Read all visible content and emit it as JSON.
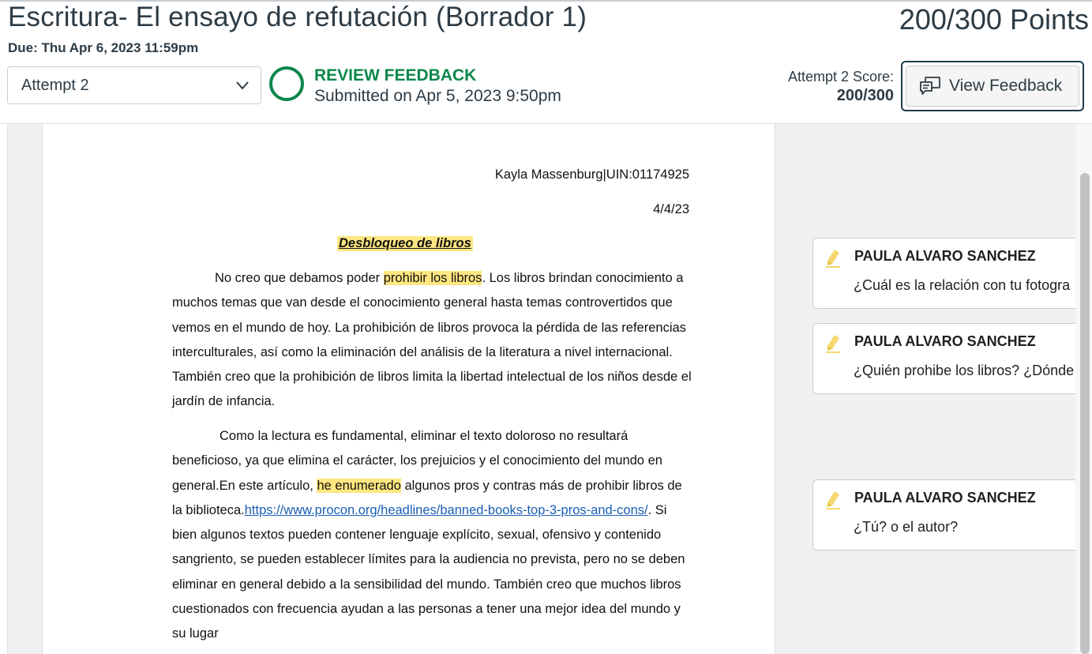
{
  "header": {
    "title": "Escritura- El ensayo de refutación (Borrador 1)",
    "points": "200/300 Points",
    "due": "Due: Thu Apr 6, 2023 11:59pm"
  },
  "attempt": {
    "selected": "Attempt 2",
    "status_label": "REVIEW FEEDBACK",
    "submitted": "Submitted on Apr 5, 2023 9:50pm",
    "score_label": "Attempt 2 Score:",
    "score_value": "200/300",
    "view_feedback_label": "View Feedback"
  },
  "document": {
    "author_line": "Kayla Massenburg|UIN:01174925",
    "date": "4/4/23",
    "title": "Desbloqueo de libros",
    "p1": {
      "before": "No creo que debamos poder ",
      "highlight": "prohibir los libros",
      "after": ". Los libros brindan conocimiento a muchos temas que van desde el conocimiento general hasta temas controvertidos que vemos en el mundo de hoy. La prohibición de libros provoca la pérdida de las referencias interculturales, así como la eliminación del análisis de la literatura a nivel internacional. También creo que la prohibición de libros limita la libertad intelectual de los niños desde el jardín de infancia."
    },
    "p2": {
      "before": "Como la lectura es fundamental, eliminar el texto doloroso no resultará beneficioso, ya que elimina el carácter, los prejuicios y el conocimiento del mundo en general.En este artículo, ",
      "highlight": "he enumerado",
      "middle": " algunos pros y contras más de prohibir libros de la biblioteca.",
      "link": "https://www.procon.org/headlines/banned-books-top-3-pros-and-cons/",
      "after": ". Si bien algunos textos pueden contener lenguaje explícito, sexual, ofensivo y contenido sangriento, se pueden establecer límites para la audiencia no prevista, pero no se deben eliminar en general debido a la sensibilidad del mundo. También creo que muchos libros cuestionados con frecuencia ayudan a las personas a tener una mejor idea del mundo y su lugar"
    }
  },
  "comments": [
    {
      "author": "PAULA ALVARO SANCHEZ",
      "text": "¿Cuál es la relación con tu fotogra"
    },
    {
      "author": "PAULA ALVARO SANCHEZ",
      "text": "¿Quién prohibe los libros? ¿Dónde"
    },
    {
      "author": "PAULA ALVARO SANCHEZ",
      "text": "¿Tú? o el autor?"
    }
  ],
  "colors": {
    "status_green": "#0b874b",
    "highlight": "#ffe680",
    "link": "#1a5fb4",
    "button_border": "#1c3b4e"
  },
  "icons": [
    "chevron-down-icon",
    "status-circle-icon",
    "feedback-icon",
    "pencil-highlight-icon"
  ]
}
